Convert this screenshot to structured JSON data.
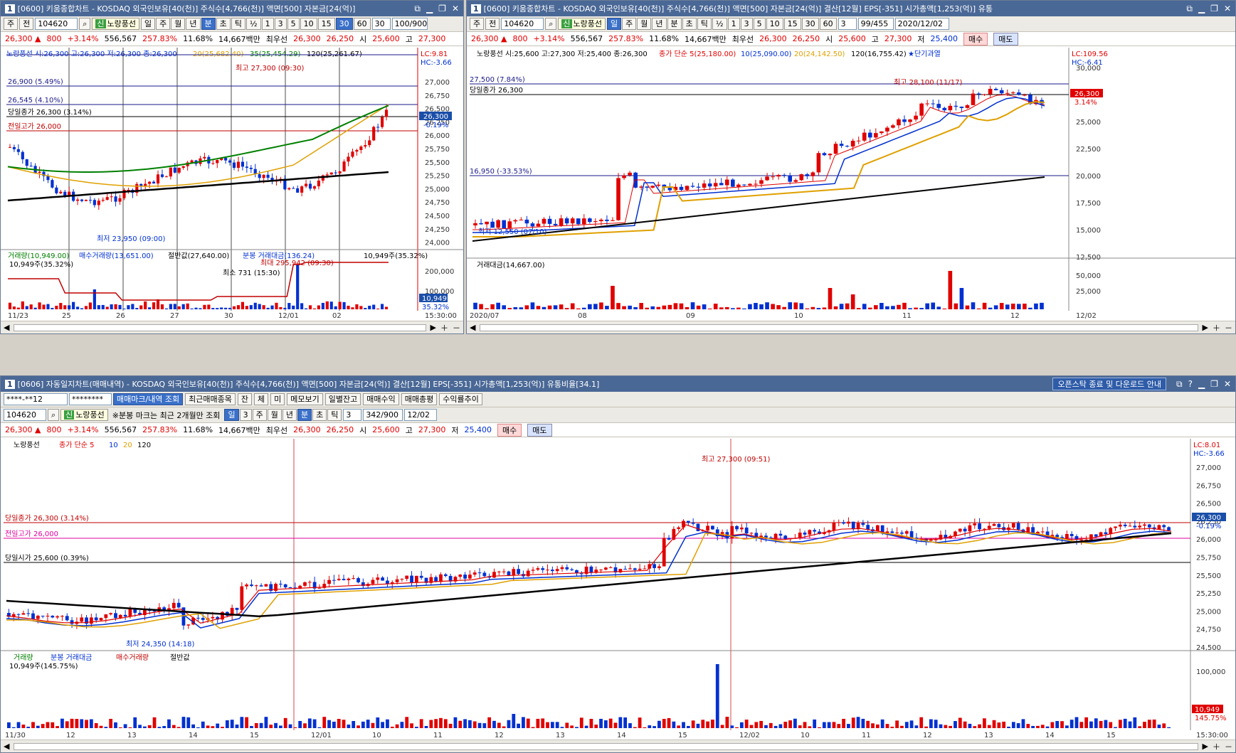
{
  "win1": {
    "num": "1",
    "title": "[0600] 키움종합차트 - KOSDAQ 외국인보유[40(천)] 주식수[4,766(천)] 액면[500] 자본금[24(억)]",
    "code": "104620",
    "name": "노랑풍선",
    "badge": "신",
    "mode_label": "주",
    "mode2": "전",
    "periods": [
      "일",
      "주",
      "월",
      "년",
      "분",
      "초",
      "틱",
      "½",
      "1",
      "3",
      "5",
      "10",
      "15",
      "30",
      "60"
    ],
    "period_input": "30",
    "count": "100/900",
    "quote": {
      "price": "26,300 ▲",
      "change": "800",
      "pct": "+3.14%",
      "vol": "556,567",
      "turnover": "257.83%",
      "rate": "11.68%",
      "amount": "14,667백만",
      "best_label": "최우선",
      "best1": "26,300",
      "best2": "26,250",
      "open_l": "시",
      "open": "25,600",
      "high_l": "고",
      "high": "27,300"
    },
    "legend_price": "노랑풍선 시:26,300 고:26,300 저:26,300 종:26,300",
    "ma_legend": [
      "20(25,682.40)",
      "35(25,454.29)",
      "120(25,261.67)"
    ],
    "levels": [
      {
        "text": "26,900 (5.49%)"
      },
      {
        "text": "26,545 (4.10%)"
      },
      {
        "text": "당일종가 26,300 (3.14%)"
      },
      {
        "text": "전일고가 26,000"
      }
    ],
    "high_note": "최고 27,300 (09:30)",
    "low_note": "최저 23,950 (09:00)",
    "yaxis": [
      "27,000",
      "26,750",
      "26,500",
      "26,250",
      "26,000",
      "25,750",
      "25,500",
      "25,250",
      "25,000",
      "24,750",
      "24,500",
      "24,250",
      "24,000"
    ],
    "lc": "LC:9.81",
    "hc": "HC:-3.66",
    "tag_price": "26,300",
    "tag_pct": "-0.19%",
    "vol_legend": [
      "거래량(10,949.00)",
      "매수거래량(13,651.00)",
      "절반값(27,640.00)",
      "분봉 거래대금(136.24)"
    ],
    "vol_right": "10,949주(35.32%)",
    "vol_left": "10,949주(35.32%)",
    "vol_high": "최대 295,942 (09:30)",
    "vol_low": "최소 731 (15:30)",
    "vol_axis": [
      "200,000",
      "100,000"
    ],
    "vol_tag": "10,949",
    "vol_tag_pct": "35.32%",
    "xlabels": [
      "11/23",
      "25",
      "26",
      "27",
      "30",
      "12/01",
      "02"
    ],
    "time": "15:30:00"
  },
  "win2": {
    "num": "1",
    "title": "[0600] 키움종합차트 - KOSDAQ 외국인보유[40(천)] 주식수[4,766(천)] 액면[500] 자본금[24(억)] 결산[12월] EPS[-351] 시가총액[1,253(억)] 유통",
    "code": "104620",
    "name": "노랑풍선",
    "badge": "신",
    "periods": [
      "일",
      "주",
      "월",
      "년",
      "분",
      "초",
      "틱",
      "½",
      "1",
      "3",
      "5",
      "10",
      "15",
      "30",
      "60"
    ],
    "period_input": "3",
    "count": "99/455",
    "date": "2020/12/02",
    "quote": {
      "price": "26,300 ▲",
      "change": "800",
      "pct": "+3.14%",
      "vol": "556,567",
      "turnover": "257.83%",
      "rate": "11.68%",
      "amount": "14,667백만",
      "best_label": "최우선",
      "best1": "26,300",
      "best2": "26,250",
      "open_l": "시",
      "open": "25,600",
      "high_l": "고",
      "high": "27,300",
      "low_l": "저",
      "low": "25,400",
      "buy": "매수",
      "sell": "매도"
    },
    "legend_price": "노랑풍선 시:25,600 고:27,300 저:25,400 종:26,300",
    "ma_legend": [
      "종가 단순 5(25,180.00)",
      "10(25,090.00)",
      "20(24,142.50)",
      "120(16,755.42)"
    ],
    "short_label": "★단기과열",
    "levels": [
      {
        "text": "27,500 (7.84%)"
      },
      {
        "text": "당일종가 26,300"
      },
      {
        "text": "16,950 (-33.53%)"
      }
    ],
    "high_note": "최고 28,100 (11/17)",
    "low_note": "최저 12,550 (07/10)",
    "yaxis": [
      "30,000",
      "27,500",
      "25,000",
      "22,500",
      "20,000",
      "17,500",
      "15,000",
      "12,500"
    ],
    "lc": "LC:109.56",
    "hc": "HC:-6.41",
    "tag_price": "26,300",
    "tag_pct": "3.14%",
    "vol_legend": "거래대금(14,667.00)",
    "vol_axis": [
      "50,000",
      "25,000"
    ],
    "xlabels": [
      "2020/07",
      "08",
      "09",
      "10",
      "11",
      "12"
    ],
    "xright": "12/02"
  },
  "win3": {
    "num": "1",
    "title": "[0606] 자동일지차트(매매내역) - KOSDAQ 외국인보유[40(천)] 주식수[4,766(천)] 액면[500] 자본금[24(억)] 결산[12월] EPS[-351] 시가총액[1,253(억)] 유통비율[34.1]",
    "notice": "오픈스탁 종료 및 다운로드 안내",
    "account": "****-**12",
    "password": "********",
    "tabs": [
      "매매마크/내역 조회",
      "최근매매종목",
      "잔",
      "체",
      "미",
      "메모보기",
      "일별잔고",
      "매매수익",
      "매매총평",
      "수익률추이"
    ],
    "code": "104620",
    "name": "노랑풍선",
    "badge": "신",
    "note": "※분봉 마크는 최근 2개월만 조회",
    "periods": [
      "일",
      "3",
      "주",
      "월",
      "년",
      "분",
      "초",
      "틱"
    ],
    "period_input": "3",
    "count": "342/900",
    "date": "12/02",
    "quote": {
      "price": "26,300 ▲",
      "change": "800",
      "pct": "+3.14%",
      "vol": "556,567",
      "turnover": "257.83%",
      "rate": "11.68%",
      "amount": "14,667백만",
      "best_label": "최우선",
      "best1": "26,300",
      "best2": "26,250",
      "open_l": "시",
      "open": "25,600",
      "high_l": "고",
      "high": "27,300",
      "low_l": "저",
      "low": "25,400",
      "buy": "매수",
      "sell": "매도"
    },
    "legend_name": "노랑풍선",
    "ma_legend": [
      "종가 단순 5",
      "10",
      "20",
      "120"
    ],
    "levels": [
      {
        "text": "당일종가 26,300 (3.14%)"
      },
      {
        "text": "전일고가 26,000"
      },
      {
        "text": "당일시가 25,600 (0.39%)"
      }
    ],
    "high_note": "최고 27,300 (09:51)",
    "low_note": "최저 24,350 (14:18)",
    "yaxis": [
      "27,000",
      "26,750",
      "26,500",
      "26,250",
      "26,000",
      "25,750",
      "25,500",
      "25,250",
      "25,000",
      "24,750",
      "24,500"
    ],
    "lc": "LC:8.01",
    "hc": "HC:-3.66",
    "tag_price": "26,300",
    "tag_pct": "-0.19%",
    "vol_legend": [
      "거래량",
      "분봉 거래대금",
      "매수거래량",
      "절반값"
    ],
    "vol_left": "10,949주(145.75%)",
    "vol_axis": [
      "100,000"
    ],
    "vol_tag": "10,949",
    "vol_tag_pct": "145.75%",
    "xlabels": [
      "11/30",
      "12",
      "13",
      "14",
      "15",
      "12/01",
      "10",
      "11",
      "12",
      "13",
      "14",
      "15",
      "12/02",
      "10",
      "11",
      "12",
      "13",
      "14",
      "15"
    ],
    "time": "15:30:00"
  }
}
